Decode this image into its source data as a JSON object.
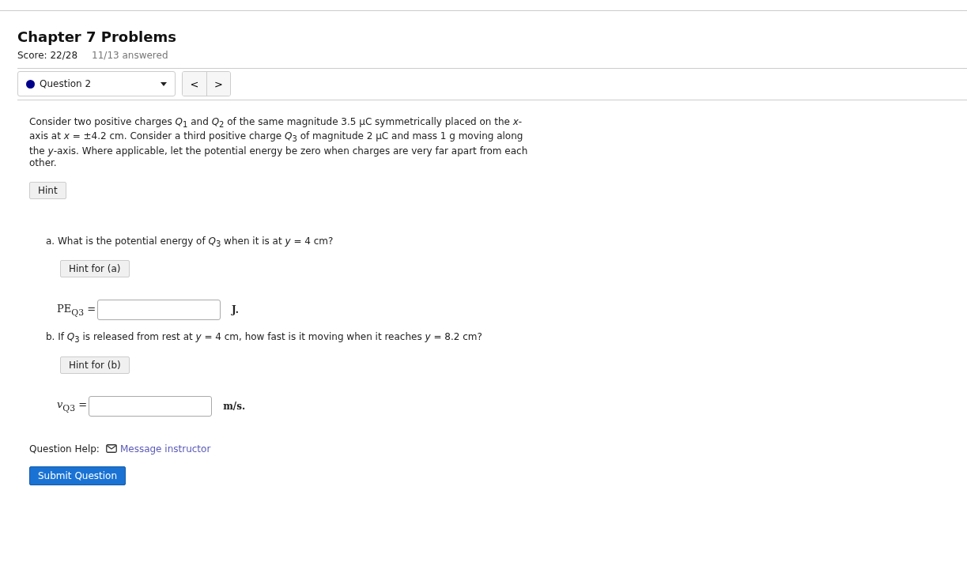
{
  "header": {
    "title": "Chapter 7 Problems",
    "score": "Score: 22/28",
    "answered": "11/13 answered"
  },
  "question_select": {
    "label": "Question 2",
    "color": "#00008b"
  },
  "nav": {
    "prev": "<",
    "next": ">"
  },
  "intro": "Consider two positive charges *Q*$_{1}$ and *Q*$_{2}$ of the same magnitude 3.5 μC symmetrically placed on the *x*-axis at *x* = ±4.2  cm. Consider a third positive charge *Q*$_{3}$ of magnitude 2 μC and mass 1 g moving along the *y*-axis. Where applicable, let the potential energy be zero when charges are very far apart from each other.",
  "hint": "Hint",
  "parts": [
    {
      "letter": "a.",
      "text": "What is the potential energy of *Q*$_{3}$ when it is at *y* = 4  cm?",
      "hint": "Hint for (a)",
      "answer_label": "PE$_{Q3}$ =",
      "unit": "J."
    },
    {
      "letter": "b.",
      "text": "If *Q*$_{3}$ is released from rest at *y* = 4  cm, how fast is it moving when it reaches *y* = 8.2  cm?",
      "hint": "Hint for (b)",
      "answer_label": "*v*$_{Q3}$ =",
      "unit": "m/s."
    }
  ],
  "help": {
    "label": "Question Help:",
    "link": "Message instructor"
  },
  "submit": "Submit Question"
}
